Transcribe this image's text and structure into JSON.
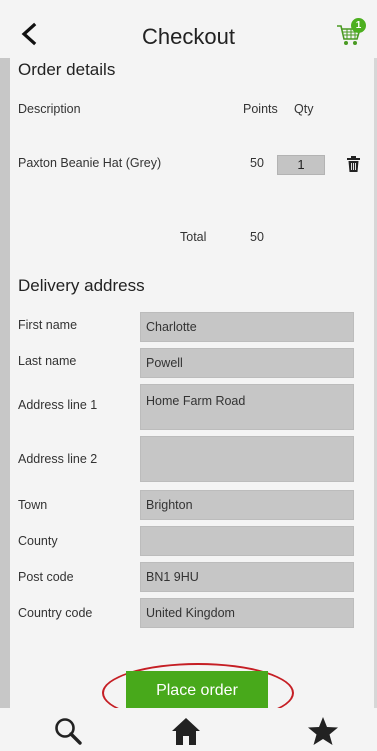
{
  "header": {
    "title": "Checkout",
    "cart_count": "1",
    "back_icon": "chevron-left-icon",
    "cart_icon": "shopping-cart-icon"
  },
  "order_details": {
    "title": "Order details",
    "columns": {
      "description": "Description",
      "points": "Points",
      "qty": "Qty"
    },
    "items": [
      {
        "description": "Paxton Beanie Hat (Grey)",
        "points": "50",
        "qty": "1"
      }
    ],
    "total_label": "Total",
    "total_value": "50"
  },
  "delivery": {
    "title": "Delivery address",
    "fields": {
      "first_name": {
        "label": "First name",
        "value": "Charlotte"
      },
      "last_name": {
        "label": "Last name",
        "value": "Powell"
      },
      "address_line_1": {
        "label": "Address line 1",
        "value": "Home Farm Road"
      },
      "address_line_2": {
        "label": "Address line 2",
        "value": ""
      },
      "town": {
        "label": "Town",
        "value": "Brighton"
      },
      "county": {
        "label": "County",
        "value": ""
      },
      "post_code": {
        "label": "Post code",
        "value": "BN1 9HU"
      },
      "country_code": {
        "label": "Country code",
        "value": "United Kingdom"
      }
    }
  },
  "place_order_label": "Place order",
  "nav": {
    "search_icon": "search-icon",
    "home_icon": "home-icon",
    "favorites_icon": "star-icon"
  },
  "colors": {
    "accent_green": "#48a91b",
    "highlight_red": "#c51e24",
    "field_grey": "#c6c6c6"
  }
}
